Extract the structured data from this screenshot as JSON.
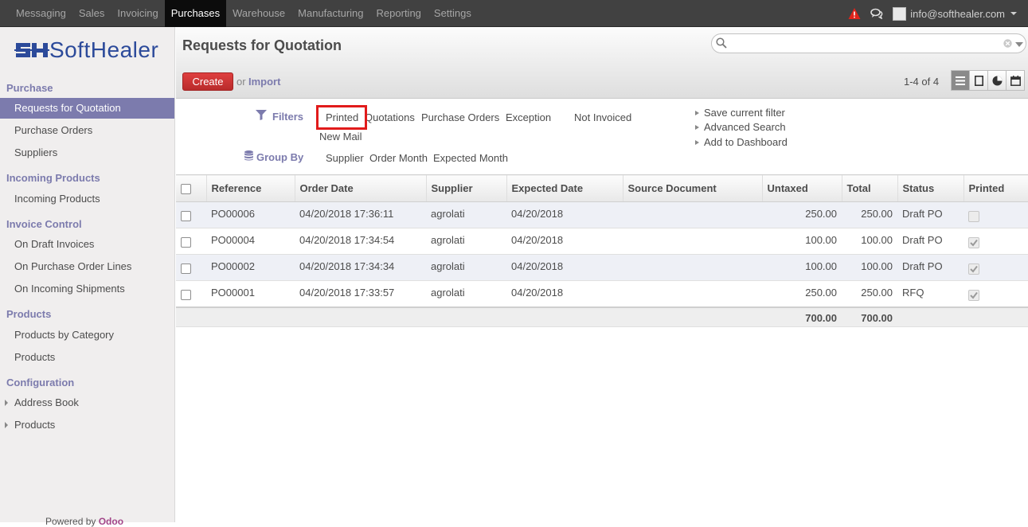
{
  "topbar": {
    "menus": [
      "Messaging",
      "Sales",
      "Invoicing",
      "Purchases",
      "Warehouse",
      "Manufacturing",
      "Reporting",
      "Settings"
    ],
    "active_menu": "Purchases",
    "user_email": "info@softhealer.com"
  },
  "logo": {
    "text": "SoftHealer"
  },
  "sidebar": {
    "sections": [
      {
        "title": "Purchase",
        "items": [
          "Requests for Quotation",
          "Purchase Orders",
          "Suppliers"
        ]
      },
      {
        "title": "Incoming Products",
        "items": [
          "Incoming Products"
        ]
      },
      {
        "title": "Invoice Control",
        "items": [
          "On Draft Invoices",
          "On Purchase Order Lines",
          "On Incoming Shipments"
        ]
      },
      {
        "title": "Products",
        "items": [
          "Products by Category",
          "Products"
        ]
      },
      {
        "title": "Configuration",
        "items": [
          "Address Book",
          "Products"
        ]
      }
    ],
    "active_item": "Requests for Quotation",
    "powered_by": "Powered by",
    "powered_brand": "Odoo"
  },
  "header": {
    "title": "Requests for Quotation",
    "search_value": "",
    "create_label": "Create",
    "or_label": "or",
    "import_label": "Import",
    "pager": "1-4 of 4"
  },
  "filters": {
    "filters_title": "Filters",
    "options": [
      "Printed",
      "Quotations",
      "Purchase Orders",
      "Exception",
      "Not Invoiced",
      "New Mail"
    ],
    "highlighted": "Printed",
    "group_by_title": "Group By",
    "group_by": [
      "Supplier",
      "Order Month",
      "Expected Month"
    ],
    "actions": [
      "Save current filter",
      "Advanced Search",
      "Add to Dashboard"
    ]
  },
  "table": {
    "columns": [
      "Reference",
      "Order Date",
      "Supplier",
      "Expected Date",
      "Source Document",
      "Untaxed",
      "Total",
      "Status",
      "Printed"
    ],
    "rows": [
      {
        "reference": "PO00006",
        "order_date": "04/20/2018 17:36:11",
        "supplier": "agrolati",
        "expected_date": "04/20/2018",
        "source": "",
        "untaxed": "250.00",
        "total": "250.00",
        "status": "Draft PO",
        "printed": false
      },
      {
        "reference": "PO00004",
        "order_date": "04/20/2018 17:34:54",
        "supplier": "agrolati",
        "expected_date": "04/20/2018",
        "source": "",
        "untaxed": "100.00",
        "total": "100.00",
        "status": "Draft PO",
        "printed": true
      },
      {
        "reference": "PO00002",
        "order_date": "04/20/2018 17:34:34",
        "supplier": "agrolati",
        "expected_date": "04/20/2018",
        "source": "",
        "untaxed": "100.00",
        "total": "100.00",
        "status": "Draft PO",
        "printed": true
      },
      {
        "reference": "PO00001",
        "order_date": "04/20/2018 17:33:57",
        "supplier": "agrolati",
        "expected_date": "04/20/2018",
        "source": "",
        "untaxed": "250.00",
        "total": "250.00",
        "status": "RFQ",
        "printed": true
      }
    ],
    "totals": {
      "untaxed": "700.00",
      "total": "700.00"
    }
  },
  "colors": {
    "accent": "#7c7bad",
    "create": "#dc3b3b",
    "topbar": "#414141",
    "highlight_box": "#e11b1b"
  }
}
